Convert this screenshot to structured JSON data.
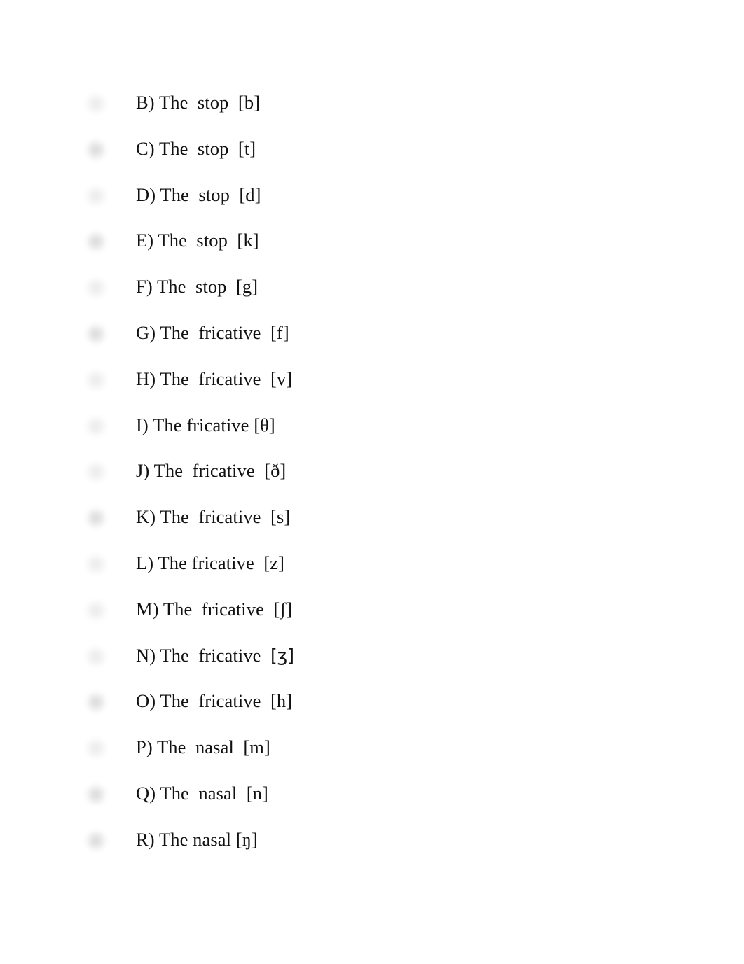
{
  "document": {
    "page_background": "#ffffff",
    "text_color": "#111111",
    "body_font_size_px": 26.5
  },
  "options": [
    {
      "id": "B",
      "label": "B)",
      "stem": "The  stop",
      "symbol": "[b]",
      "full_text": "B) The  stop  [b]",
      "marker": "blurred-circle",
      "marker_intensity": "faint"
    },
    {
      "id": "C",
      "label": "C)",
      "stem": "The  stop",
      "symbol": "[t]",
      "full_text": "C) The  stop  [t]",
      "marker": "blurred-circle",
      "marker_intensity": "dark"
    },
    {
      "id": "D",
      "label": "D)",
      "stem": "The  stop",
      "symbol": "[d]",
      "full_text": "D) The  stop  [d]",
      "marker": "blurred-circle",
      "marker_intensity": "faint"
    },
    {
      "id": "E",
      "label": "E)",
      "stem": "The  stop",
      "symbol": "[k]",
      "full_text": "E) The  stop  [k]",
      "marker": "blurred-circle",
      "marker_intensity": "dark"
    },
    {
      "id": "F",
      "label": "F)",
      "stem": "The  stop",
      "symbol": "[g]",
      "full_text": "F) The  stop  [g]",
      "marker": "blurred-circle",
      "marker_intensity": "faint"
    },
    {
      "id": "G",
      "label": "G)",
      "stem": "The  fricative",
      "symbol": "[f]",
      "full_text": "G) The  fricative  [f]",
      "marker": "blurred-circle",
      "marker_intensity": "dark"
    },
    {
      "id": "H",
      "label": "H)",
      "stem": "The  fricative",
      "symbol": "[v]",
      "full_text": "H) The  fricative  [v]",
      "marker": "blurred-circle",
      "marker_intensity": "faint"
    },
    {
      "id": "I",
      "label": "I)",
      "stem": "The fricative",
      "symbol": "[θ]",
      "full_text": "I) The fricative [θ]",
      "marker": "blurred-circle",
      "marker_intensity": "faint"
    },
    {
      "id": "J",
      "label": "J)",
      "stem": "The  fricative",
      "symbol": "[ð]",
      "full_text": "J) The  fricative  [ð]",
      "marker": "blurred-circle",
      "marker_intensity": "faint"
    },
    {
      "id": "K",
      "label": "K)",
      "stem": "The  fricative",
      "symbol": "[s]",
      "full_text": "K) The  fricative  [s]",
      "marker": "blurred-circle",
      "marker_intensity": "dark"
    },
    {
      "id": "L",
      "label": "L)",
      "stem": "The fricative",
      "symbol": "[z]",
      "full_text": "L) The fricative  [z]",
      "marker": "blurred-circle",
      "marker_intensity": "faint"
    },
    {
      "id": "M",
      "label": "M)",
      "stem": "The  fricative",
      "symbol": "[ʃ]",
      "full_text": "M) The  fricative  [ʃ]",
      "marker": "blurred-circle",
      "marker_intensity": "faint"
    },
    {
      "id": "N",
      "label": "N)",
      "stem": "The  fricative",
      "symbol": "[ʒ]",
      "full_text": "N) The  fricative  [ʒ]",
      "marker": "blurred-circle",
      "marker_intensity": "faint"
    },
    {
      "id": "O",
      "label": "O)",
      "stem": "The  fricative",
      "symbol": "[h]",
      "full_text": "O) The  fricative  [h]",
      "marker": "blurred-circle",
      "marker_intensity": "dark"
    },
    {
      "id": "P",
      "label": "P)",
      "stem": "The  nasal",
      "symbol": "[m]",
      "full_text": "P) The  nasal  [m]",
      "marker": "blurred-circle",
      "marker_intensity": "faint"
    },
    {
      "id": "Q",
      "label": "Q)",
      "stem": "The  nasal",
      "symbol": "[n]",
      "full_text": "Q) The  nasal  [n]",
      "marker": "blurred-circle",
      "marker_intensity": "dark"
    },
    {
      "id": "R",
      "label": "R)",
      "stem": "The nasal",
      "symbol": "[ŋ]",
      "full_text": "R) The nasal [ŋ]",
      "marker": "blurred-circle",
      "marker_intensity": "dark"
    }
  ]
}
